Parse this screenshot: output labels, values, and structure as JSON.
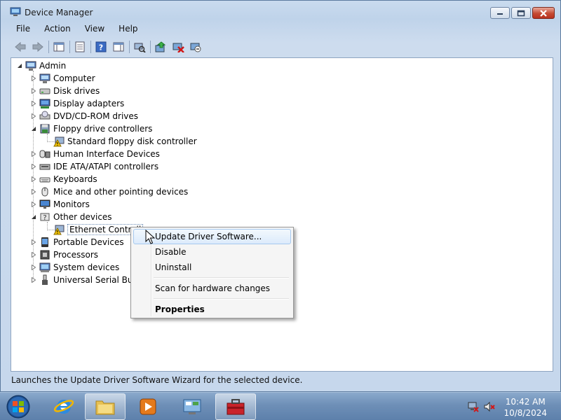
{
  "window": {
    "title": "Device Manager"
  },
  "menu": [
    "File",
    "Action",
    "View",
    "Help"
  ],
  "tree": {
    "root": "Admin",
    "items": [
      {
        "label": "Computer",
        "icon": "computer-icon"
      },
      {
        "label": "Disk drives",
        "icon": "disk-drive-icon"
      },
      {
        "label": "Display adapters",
        "icon": "display-adapter-icon"
      },
      {
        "label": "DVD/CD-ROM drives",
        "icon": "dvd-drive-icon"
      },
      {
        "label": "Floppy drive controllers",
        "icon": "floppy-controller-icon",
        "expanded": true
      },
      {
        "label": "Standard floppy disk controller",
        "icon": "warning-device-icon",
        "child": true
      },
      {
        "label": "Human Interface Devices",
        "icon": "hid-icon"
      },
      {
        "label": "IDE ATA/ATAPI controllers",
        "icon": "ide-controller-icon"
      },
      {
        "label": "Keyboards",
        "icon": "keyboard-icon"
      },
      {
        "label": "Mice and other pointing devices",
        "icon": "mouse-icon"
      },
      {
        "label": "Monitors",
        "icon": "monitor-icon"
      },
      {
        "label": "Other devices",
        "icon": "other-devices-icon",
        "expanded": true
      },
      {
        "label": "Ethernet Controll",
        "icon": "warning-device-icon",
        "child": true,
        "selected": true
      },
      {
        "label": "Portable Devices",
        "icon": "portable-device-icon"
      },
      {
        "label": "Processors",
        "icon": "processor-icon"
      },
      {
        "label": "System devices",
        "icon": "system-device-icon"
      },
      {
        "label": "Universal Serial Bus c",
        "icon": "usb-icon"
      }
    ]
  },
  "context_menu": {
    "update": "Update Driver Software...",
    "disable": "Disable",
    "uninstall": "Uninstall",
    "scan": "Scan for hardware changes",
    "properties": "Properties"
  },
  "status": "Launches the Update Driver Software Wizard for the selected device.",
  "clock": {
    "time": "10:42 AM",
    "date": "10/8/2024"
  },
  "colors": {
    "warning": "#f2c200",
    "accent": "#3a6ea5"
  }
}
